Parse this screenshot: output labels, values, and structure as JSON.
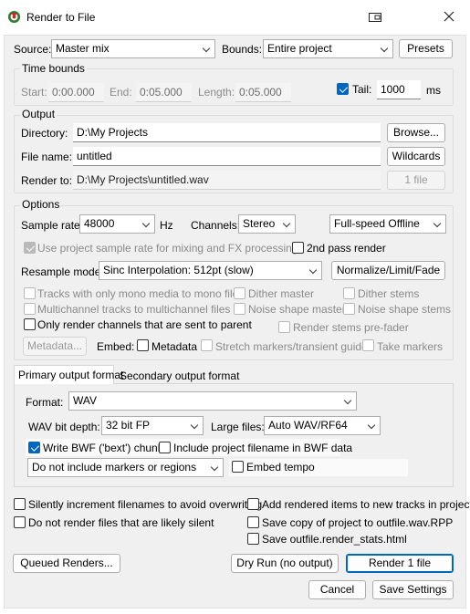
{
  "window": {
    "title": "Render to File"
  },
  "source": {
    "label": "Source:",
    "value": "Master mix"
  },
  "bounds": {
    "label": "Bounds:",
    "value": "Entire project"
  },
  "presets_label": "Presets",
  "time_bounds": {
    "title": "Time bounds",
    "start_label": "Start:",
    "start": "0:00.000",
    "end_label": "End:",
    "end": "0:05.000",
    "length_label": "Length:",
    "length": "0:05.000",
    "tail_label": "Tail:",
    "tail_value": "1000",
    "tail_unit": "ms"
  },
  "output": {
    "title": "Output",
    "directory_label": "Directory:",
    "directory": "D:\\My Projects",
    "browse_label": "Browse...",
    "filename_label": "File name:",
    "filename": "untitled",
    "wildcards_label": "Wildcards",
    "render_to_label": "Render to:",
    "render_to": "D:\\My Projects\\untitled.wav",
    "file_count": "1 file"
  },
  "options": {
    "title": "Options",
    "sample_rate_label": "Sample rate:",
    "sample_rate": "48000",
    "hz": "Hz",
    "channels_label": "Channels:",
    "channels": "Stereo",
    "speed": "Full-speed Offline",
    "use_project_rate": "Use project sample rate for mixing and FX processing",
    "second_pass": "2nd pass render",
    "resample_label": "Resample mode:",
    "resample": "Sinc Interpolation: 512pt (slow)",
    "normalize_label": "Normalize/Limit/Fade",
    "mono_tracks": "Tracks with only mono media to mono files",
    "dither_master": "Dither master",
    "dither_stems": "Dither stems",
    "multichannel": "Multichannel tracks to multichannel files",
    "noise_master": "Noise shape master",
    "noise_stems": "Noise shape stems",
    "only_parent": "Only render channels that are sent to parent",
    "stems_prefader": "Render stems pre-fader",
    "metadata_btn": "Metadata...",
    "embed_label": "Embed:",
    "embed_metadata": "Metadata",
    "stretch_markers": "Stretch markers/transient guides",
    "take_markers": "Take markers"
  },
  "format": {
    "tab_primary": "Primary output format",
    "tab_secondary": "Secondary output format",
    "format_label": "Format:",
    "format_value": "WAV",
    "bit_depth_label": "WAV bit depth:",
    "bit_depth": "32 bit FP",
    "large_files_label": "Large files:",
    "large_files": "Auto WAV/RF64",
    "write_bwf": "Write BWF ('bext') chunk",
    "include_filename": "Include project filename in BWF data",
    "markers": "Do not include markers or regions",
    "embed_tempo": "Embed tempo"
  },
  "misc": {
    "silently_increment": "Silently increment filenames to avoid overwriting",
    "add_rendered": "Add rendered items to new tracks in project",
    "no_silent": "Do not render files that are likely silent",
    "save_copy": "Save copy of project to outfile.wav.RPP",
    "save_stats": "Save outfile.render_stats.html"
  },
  "buttons": {
    "queued": "Queued Renders...",
    "dry_run": "Dry Run (no output)",
    "render": "Render 1 file",
    "cancel": "Cancel",
    "save_settings": "Save Settings"
  },
  "colors": {
    "accent": "#0067c0",
    "dialog_bg": "#f0f0f0"
  },
  "icons": [
    "reaper-logo-icon",
    "dock-window-icon",
    "close-icon"
  ]
}
